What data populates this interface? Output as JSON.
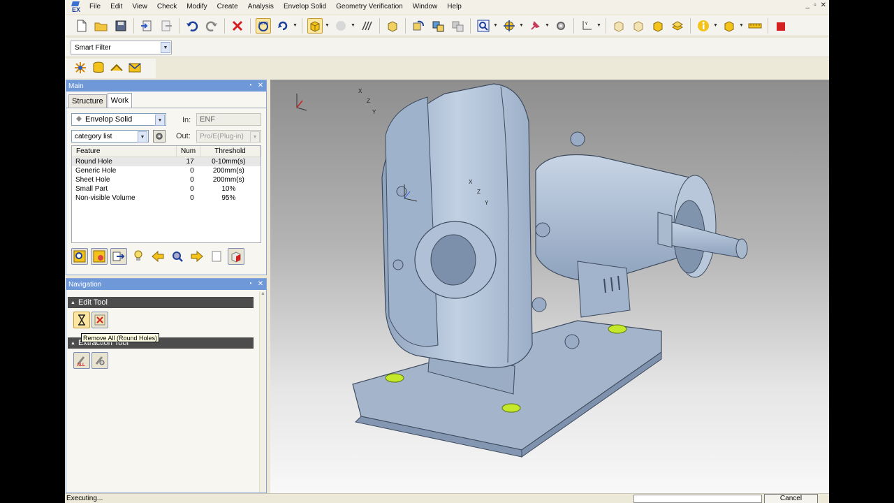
{
  "menu": [
    "File",
    "Edit",
    "View",
    "Check",
    "Modify",
    "Create",
    "Analysis",
    "Envelop Solid",
    "Geometry Verification",
    "Window",
    "Help"
  ],
  "window_controls": [
    "_",
    "▫",
    "✕"
  ],
  "filter": {
    "value": "Smart Filter"
  },
  "main_panel": {
    "title": "Main",
    "tabs": [
      "Structure",
      "Work"
    ],
    "active_tab": "Work",
    "mode_select": "Envelop Solid",
    "category_select": "category list",
    "in_label": "In:",
    "in_value": "ENF",
    "out_label": "Out:",
    "out_value": "Pro/E(Plug-in)",
    "table": {
      "headers": [
        "Feature",
        "Num",
        "Threshold"
      ],
      "rows": [
        {
          "feature": "Round Hole",
          "num": "17",
          "threshold": "0-10mm(s)"
        },
        {
          "feature": "Generic Hole",
          "num": "0",
          "threshold": "200mm(s)"
        },
        {
          "feature": "Sheet Hole",
          "num": "0",
          "threshold": "200mm(s)"
        },
        {
          "feature": "Small Part",
          "num": "0",
          "threshold": "10%"
        },
        {
          "feature": "Non-visible Volume",
          "num": "0",
          "threshold": "95%"
        }
      ]
    }
  },
  "navigation_panel": {
    "title": "Navigation",
    "sections": [
      "Edit Tool",
      "Extraction Tool"
    ],
    "tooltip": "Remove All (Round Holes)"
  },
  "status": {
    "text": "Executing...",
    "cancel": "Cancel"
  },
  "axis_labels": {
    "x": "X",
    "y": "Y",
    "z": "Z"
  },
  "colors": {
    "panel_header": "#6e98d8",
    "model": "#b5c3d8",
    "highlight": "#c6e82a"
  }
}
